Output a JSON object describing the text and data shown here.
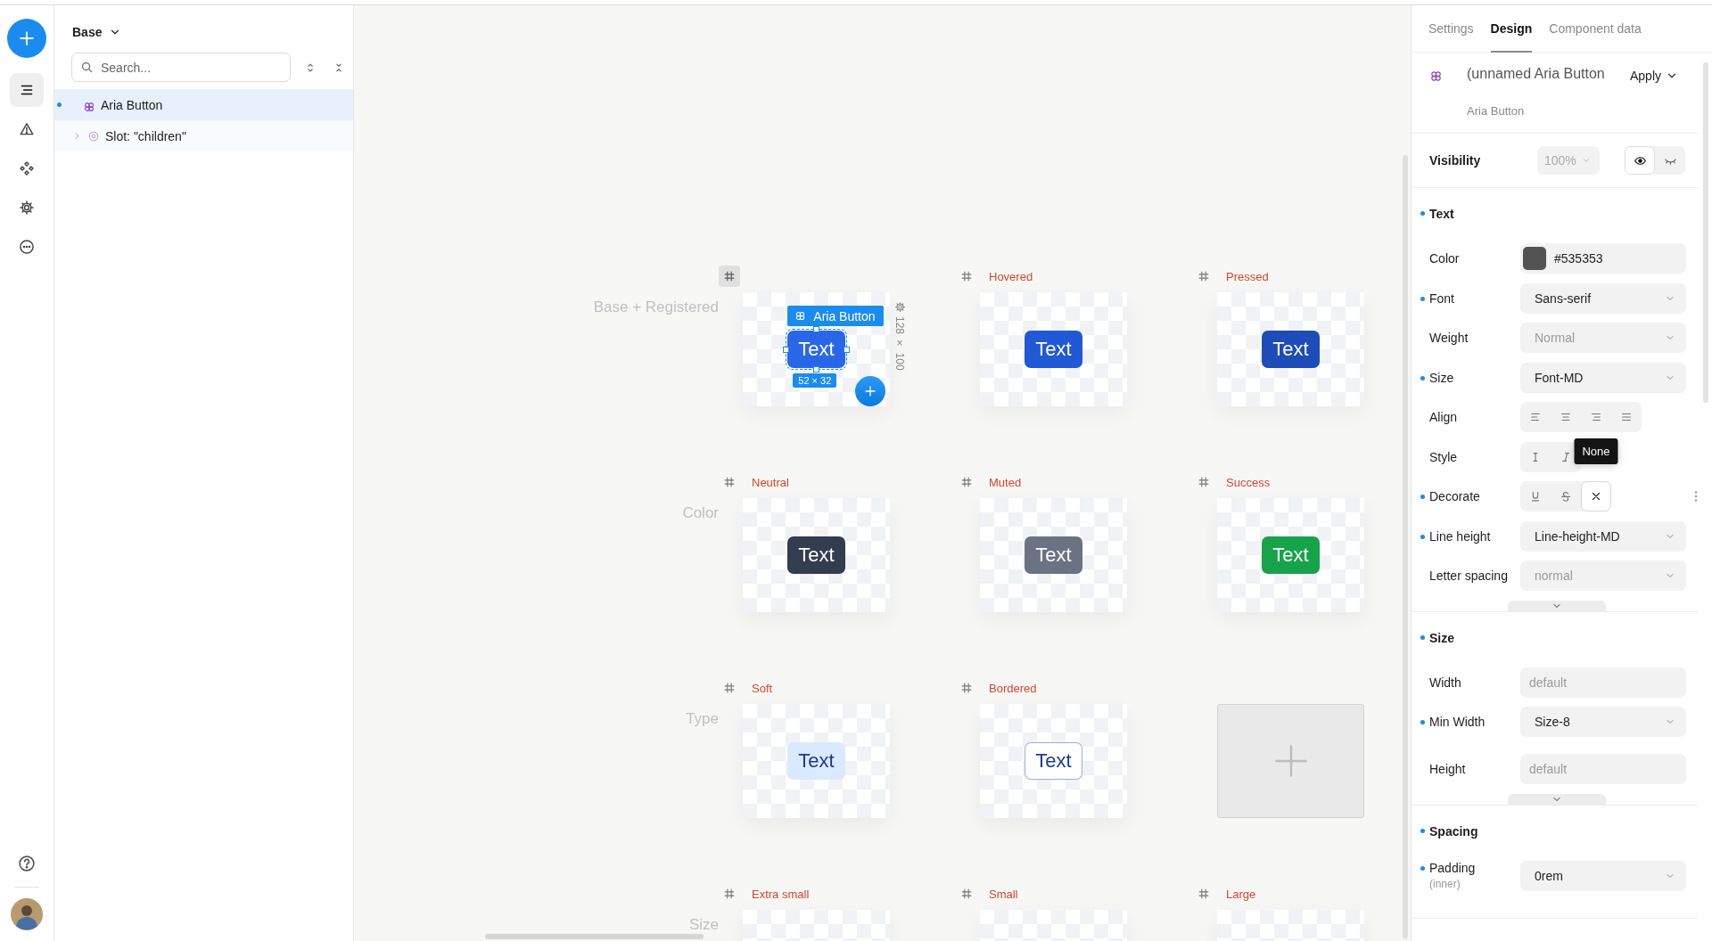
{
  "rail": {
    "items": [
      {
        "kind": "layers",
        "selected": true
      },
      {
        "kind": "warnings",
        "selected": false
      },
      {
        "kind": "components",
        "selected": false
      },
      {
        "kind": "settings",
        "selected": false
      },
      {
        "kind": "more",
        "selected": false
      }
    ]
  },
  "sidebar": {
    "title": "Base",
    "search": {
      "placeholder": "Search..."
    },
    "tree": [
      {
        "label": "Aria Button",
        "kind": "component",
        "selected": true,
        "modified": true,
        "children": [
          {
            "label": "Slot: \"children\"",
            "kind": "slot",
            "selected": false,
            "modified": false,
            "expanded": false
          }
        ]
      }
    ]
  },
  "canvas": {
    "selection": {
      "component": "Aria Button",
      "size": "52 × 32",
      "frame_size": "128 × 100"
    },
    "rows": [
      {
        "label": "Base + Registered",
        "cells": [
          {
            "kind": "variant",
            "button": "Text",
            "selected": true
          },
          {
            "kind": "variant",
            "label": "Hovered",
            "button": "Text",
            "selected": false
          },
          {
            "kind": "variant",
            "label": "Pressed",
            "button": "Text",
            "selected": false
          }
        ]
      },
      {
        "label": "Color",
        "cells": [
          {
            "kind": "variant",
            "label": "Neutral",
            "button": "Text",
            "selected": false
          },
          {
            "kind": "variant",
            "label": "Muted",
            "button": "Text",
            "selected": false
          },
          {
            "kind": "variant",
            "label": "Success",
            "button": "Text",
            "selected": false
          }
        ]
      },
      {
        "label": "Type",
        "cells": [
          {
            "kind": "variant",
            "label": "Soft",
            "button": "Text",
            "selected": false
          },
          {
            "kind": "variant",
            "label": "Bordered",
            "button": "Text",
            "selected": false
          },
          {
            "kind": "add",
            "selected": false
          }
        ]
      },
      {
        "label": "Size",
        "cells": [
          {
            "kind": "variant",
            "label": "Extra small",
            "selected": false
          },
          {
            "kind": "variant",
            "label": "Small",
            "selected": false
          },
          {
            "kind": "variant",
            "label": "Large",
            "selected": false
          }
        ]
      }
    ]
  },
  "inspector": {
    "tabs": [
      {
        "label": "Settings",
        "selected": false
      },
      {
        "label": "Design",
        "selected": true
      },
      {
        "label": "Component data",
        "selected": false
      }
    ],
    "component": {
      "name": "(unnamed Aria Button",
      "type": "Aria Button",
      "action": "Apply"
    },
    "visibility": {
      "label": "Visibility",
      "placeholder": "100%",
      "visible": true
    },
    "sections": [
      {
        "title": "Text",
        "set": true,
        "more": true,
        "rows": [
          {
            "label": "Color",
            "set": false,
            "kind": "color",
            "value": "#535353"
          },
          {
            "label": "Font",
            "set": true,
            "kind": "select",
            "value": "Sans-serif"
          },
          {
            "label": "Weight",
            "set": false,
            "kind": "select",
            "placeholder": "Normal"
          },
          {
            "label": "Size",
            "set": true,
            "kind": "select",
            "value": "Font-MD"
          },
          {
            "label": "Align",
            "set": false,
            "kind": "toggles",
            "options": [
              {
                "kind": "align-left",
                "selected": false
              },
              {
                "kind": "align-center",
                "selected": false
              },
              {
                "kind": "align-right",
                "selected": false
              },
              {
                "kind": "justify",
                "selected": false
              }
            ]
          },
          {
            "label": "Style",
            "set": false,
            "kind": "toggles",
            "options": [
              {
                "kind": "upright",
                "selected": false
              },
              {
                "kind": "italic",
                "selected": false
              }
            ]
          },
          {
            "label": "Decorate",
            "set": true,
            "kind": "toggles",
            "menu": true,
            "options": [
              {
                "kind": "underline",
                "selected": false
              },
              {
                "kind": "strikethrough",
                "selected": false
              },
              {
                "kind": "none",
                "selected": true,
                "tooltip": "None"
              }
            ]
          },
          {
            "label": "Line height",
            "set": true,
            "kind": "select",
            "value": "Line-height-MD"
          },
          {
            "label": "Letter spacing",
            "set": false,
            "kind": "select",
            "placeholder": "normal"
          }
        ]
      },
      {
        "title": "Size",
        "set": true,
        "more": true,
        "rows": [
          {
            "label": "Width",
            "set": false,
            "kind": "input",
            "placeholder": "default"
          },
          {
            "label": "Min Width",
            "set": true,
            "kind": "select",
            "value": "Size-8"
          },
          {
            "label": "Height",
            "set": false,
            "kind": "input",
            "placeholder": "default"
          }
        ]
      },
      {
        "title": "Spacing",
        "set": true,
        "more": false,
        "rows": [
          {
            "label": "Padding",
            "sublabel": "(inner)",
            "set": true,
            "kind": "select",
            "value": "0rem"
          }
        ]
      }
    ]
  }
}
